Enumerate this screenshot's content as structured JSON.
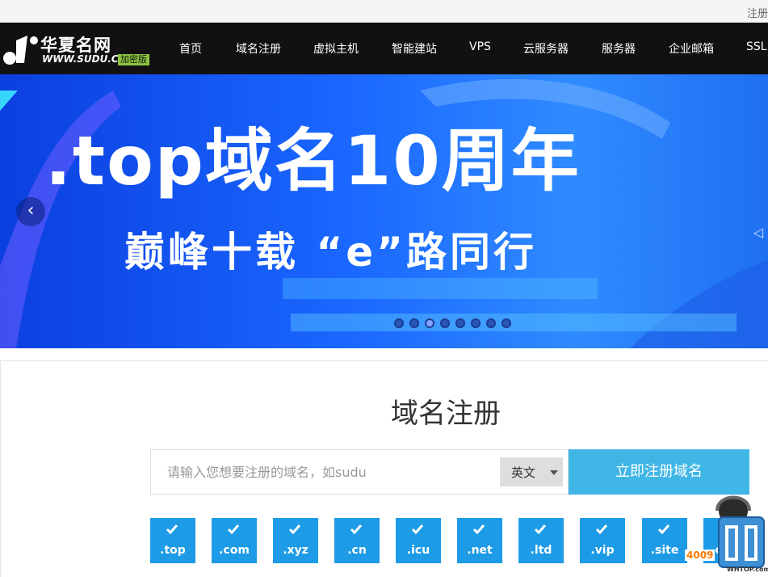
{
  "topbar": {
    "register_link": "注册"
  },
  "logo": {
    "name": "华夏名网",
    "url": "WWW.SUDU.CN",
    "badge": "加密版"
  },
  "nav": {
    "items": [
      "首页",
      "域名注册",
      "虚拟主机",
      "智能建站",
      "VPS",
      "云服务器",
      "服务器",
      "企业邮箱",
      "SSL"
    ]
  },
  "banner": {
    "headline": ".top域名10周年",
    "subline": "巅峰十载 “e”路同行",
    "slide_count": 8,
    "active_slide": 3
  },
  "domain": {
    "title": "域名注册",
    "search_placeholder": "请输入您想要注册的域名，如sudu",
    "language": "英文",
    "submit_label": "立即注册域名",
    "tlds": [
      ".top",
      ".com",
      ".xyz",
      ".cn",
      ".icu",
      ".net",
      ".ltd",
      ".vip",
      ".site",
      ".com"
    ]
  },
  "service_widget": {
    "phone": "4009",
    "brand": "WHTOP.com"
  },
  "colors": {
    "nav_bg": "#111111",
    "accent_blue": "#1d9be6",
    "button_blue": "#40b6e6",
    "banner_blue": "#1a67ff"
  }
}
